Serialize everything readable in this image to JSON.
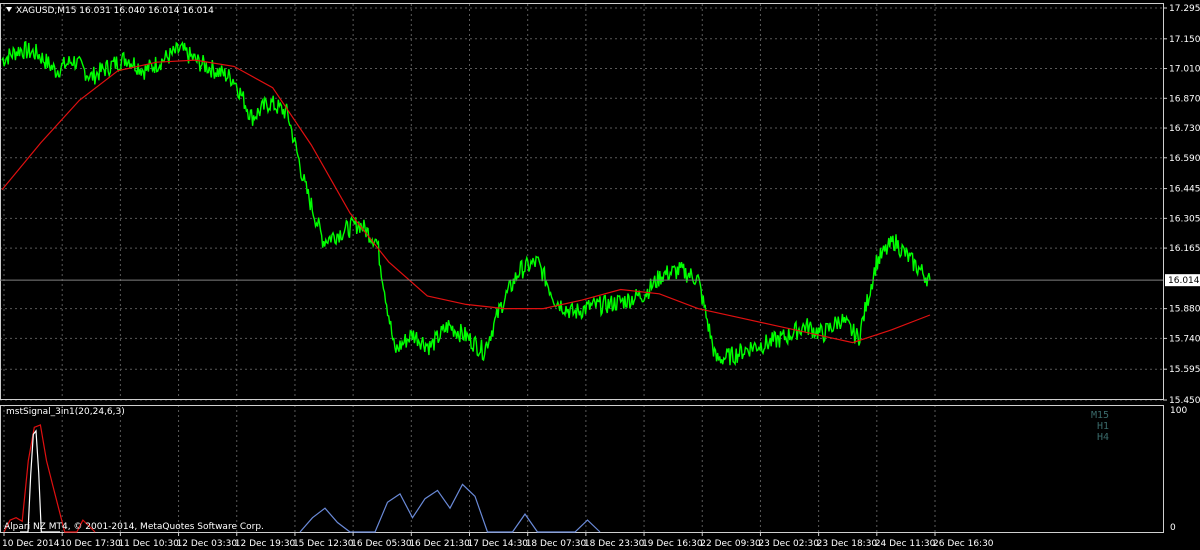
{
  "window": {
    "symbol_header": "XAGUSD,M15  16.031 16.040 16.014 16.014",
    "indicator_header": "mstSignal_3in1(20,24,6,3)",
    "copyright": "Alpari NZ MT4, © 2001-2014, MetaQuotes Software Corp.",
    "timeframes": [
      "M15",
      "H1",
      "H4"
    ],
    "indicator_scale": [
      "100",
      "0"
    ]
  },
  "colors": {
    "background": "#000000",
    "price": "#00ff00",
    "ma": "#e01010",
    "grid": "#5a5a5a",
    "current_line": "#808080",
    "current_box": "#ffffff",
    "ind_red": "#e01010",
    "ind_white": "#ffffff",
    "ind_blue": "#6a8ad8"
  },
  "chart_data": {
    "type": "line",
    "title": "XAGUSD,M15",
    "yticks": [
      "17.295",
      "17.150",
      "17.010",
      "16.870",
      "16.730",
      "16.590",
      "16.445",
      "16.305",
      "16.165",
      "15.880",
      "15.740",
      "15.595",
      "15.450"
    ],
    "current_price": "16.014",
    "x": [
      "10 Dec 2014",
      "10 Dec 17:30",
      "11 Dec 10:30",
      "12 Dec 03:30",
      "12 Dec 19:30",
      "15 Dec 12:30",
      "16 Dec 05:30",
      "16 Dec 21:30",
      "17 Dec 14:30",
      "18 Dec 07:30",
      "18 Dec 23:30",
      "19 Dec 16:30",
      "22 Dec 09:30",
      "23 Dec 02:30",
      "23 Dec 18:30",
      "24 Dec 11:30",
      "26 Dec 16:30"
    ],
    "ylim": [
      15.45,
      17.295
    ],
    "series": [
      {
        "values": [
          17.05,
          17.1,
          17.08,
          17.0,
          17.05,
          16.97,
          17.02,
          17.06,
          17.0,
          17.05,
          17.1,
          17.04,
          17.0,
          16.96,
          16.78,
          16.85,
          16.8,
          16.45,
          16.2,
          16.24,
          16.28,
          16.2,
          15.68,
          15.76,
          15.7,
          15.8,
          15.75,
          15.68,
          15.9,
          16.06,
          16.1,
          15.92,
          15.86,
          15.89,
          15.9,
          15.92,
          15.95,
          16.04,
          16.06,
          16.02,
          15.64,
          15.66,
          15.7,
          15.72,
          15.75,
          15.8,
          15.76,
          15.83,
          15.74,
          16.1,
          16.2,
          16.1,
          16.014
        ]
      },
      {
        "values": [
          16.44,
          16.66,
          16.86,
          17.0,
          17.04,
          17.05,
          17.02,
          16.92,
          16.65,
          16.33,
          16.1,
          15.94,
          15.9,
          15.88,
          15.88,
          15.92,
          15.97,
          15.95,
          15.88,
          15.84,
          15.8,
          15.76,
          15.72,
          15.78,
          15.85
        ]
      }
    ],
    "indicator": {
      "ylim": [
        0,
        100
      ],
      "series": [
        {
          "values": [
            0,
            10,
            12,
            9,
            60,
            88,
            90,
            60,
            40,
            20,
            0,
            0,
            0,
            10,
            5,
            0
          ]
        },
        {
          "values": [
            0,
            0,
            0,
            0,
            48,
            82,
            85,
            50,
            0,
            0,
            0,
            0,
            0,
            0,
            0,
            0
          ]
        },
        {
          "values": [
            0,
            12,
            20,
            8,
            0,
            0,
            0,
            25,
            32,
            12,
            28,
            35,
            20,
            40,
            30,
            0,
            0,
            0,
            15,
            0,
            0,
            0,
            0,
            10,
            0
          ]
        }
      ]
    }
  }
}
